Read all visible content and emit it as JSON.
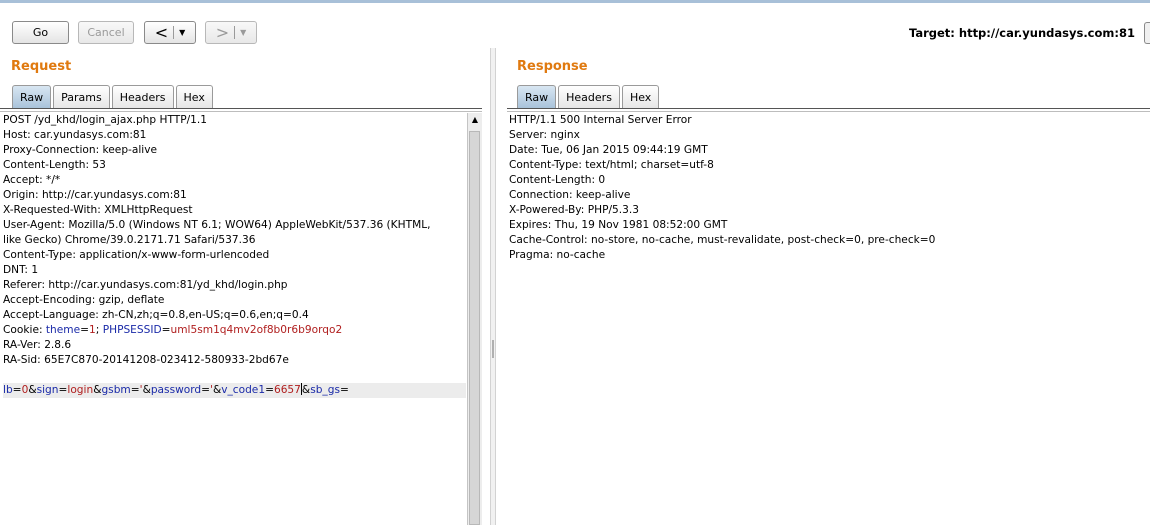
{
  "toolbar": {
    "go_label": "Go",
    "cancel_label": "Cancel",
    "back_glyph": "<",
    "forward_glyph": ">",
    "dropdown_glyph": "▼",
    "target_text": "Target: http://car.yundasys.com:81"
  },
  "request": {
    "title": "Request",
    "tabs": [
      "Raw",
      "Params",
      "Headers",
      "Hex"
    ],
    "active_tab": "Raw",
    "lines": {
      "l0": "POST /yd_khd/login_ajax.php HTTP/1.1",
      "l1": "Host: car.yundasys.com:81",
      "l2": "Proxy-Connection: keep-alive",
      "l3": "Content-Length: 53",
      "l4": "Accept: */*",
      "l5": "Origin: http://car.yundasys.com:81",
      "l6": "X-Requested-With: XMLHttpRequest",
      "l7": "User-Agent: Mozilla/5.0 (Windows NT 6.1; WOW64) AppleWebKit/537.36 (KHTML,",
      "l8": "like Gecko) Chrome/39.0.2171.71 Safari/537.36",
      "l9": "Content-Type: application/x-www-form-urlencoded",
      "l10": "DNT: 1",
      "l11": "Referer: http://car.yundasys.com:81/yd_khd/login.php",
      "l12": "Accept-Encoding: gzip, deflate",
      "l13": "Accept-Language: zh-CN,zh;q=0.8,en-US;q=0.6,en;q=0.4",
      "l15": "RA-Ver: 2.8.6",
      "l16": "RA-Sid: 65E7C870-20141208-023412-580933-2bd67e"
    },
    "cookie": {
      "prefix": "Cookie: ",
      "k1": "theme",
      "v1": "1",
      "sep": "; ",
      "k2": "PHPSESSID",
      "v2": "uml5sm1q4mv2of8b0r6b9orqo2"
    },
    "body": {
      "k1": "lb",
      "v1": "0",
      "k2": "sign",
      "v2": "login",
      "k3": "gsbm",
      "v3": "'",
      "k4": "password",
      "v4": "'",
      "k5": "v_code1",
      "v5": "6657",
      "k6": "sb_gs"
    }
  },
  "response": {
    "title": "Response",
    "tabs": [
      "Raw",
      "Headers",
      "Hex"
    ],
    "active_tab": "Raw",
    "lines": [
      "HTTP/1.1 500 Internal Server Error",
      "Server: nginx",
      "Date: Tue, 06 Jan 2015 09:44:19 GMT",
      "Content-Type: text/html; charset=utf-8",
      "Content-Length: 0",
      "Connection: keep-alive",
      "X-Powered-By: PHP/5.3.3",
      "Expires: Thu, 19 Nov 1981 08:52:00 GMT",
      "Cache-Control: no-store, no-cache, must-revalidate, post-check=0, pre-check=0",
      "Pragma: no-cache"
    ]
  }
}
